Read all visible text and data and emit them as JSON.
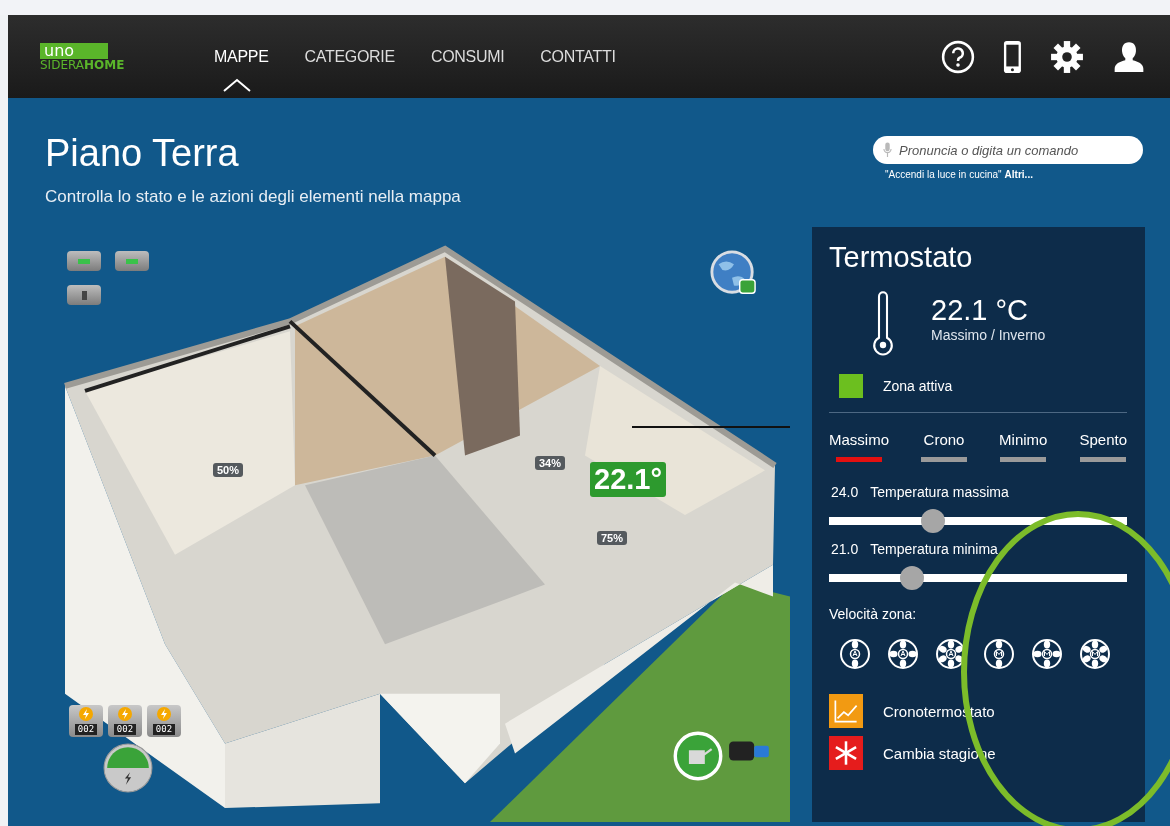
{
  "brand": {
    "top": "uno",
    "bottom_a": "SIDERA",
    "bottom_b": "HOME"
  },
  "nav": [
    {
      "label": "MAPPE",
      "selected": true
    },
    {
      "label": "CATEGORIE",
      "selected": false
    },
    {
      "label": "CONSUMI",
      "selected": false
    },
    {
      "label": "CONTATTI",
      "selected": false
    }
  ],
  "header_icons": [
    {
      "kind": "help"
    },
    {
      "kind": "phone"
    },
    {
      "kind": "settings"
    },
    {
      "kind": "user"
    }
  ],
  "page": {
    "title": "Piano Terra",
    "subtitle": "Controlla lo stato e le azioni degli elementi nella mappa"
  },
  "voice_search": {
    "placeholder": "Pronuncia o digita un comando",
    "hint": "\"Accendi la luce in cucina\"",
    "link": "Altri..."
  },
  "map": {
    "badges": [
      {
        "text": "50%",
        "kind": "humidity"
      },
      {
        "text": "34%",
        "kind": "humidity"
      },
      {
        "text": "22.1°",
        "kind": "temperature"
      },
      {
        "text": "75%",
        "kind": "humidity"
      }
    ],
    "meters": [
      {
        "reading": "002"
      },
      {
        "reading": "002"
      },
      {
        "reading": "002"
      }
    ]
  },
  "thermostat": {
    "title": "Termostato",
    "temperature": "22.1 °C",
    "mode_label": "Massimo / Inverno",
    "zone": {
      "label": "Zona attiva",
      "color": "#6cbf1f"
    },
    "modes": [
      {
        "label": "Massimo",
        "selected": true
      },
      {
        "label": "Crono",
        "selected": false
      },
      {
        "label": "Minimo",
        "selected": false
      },
      {
        "label": "Spento",
        "selected": false
      }
    ],
    "sliders": [
      {
        "value": "24.0",
        "label": "Temperatura massima",
        "level": 0.35
      },
      {
        "value": "21.0",
        "label": "Temperatura minima",
        "level": 0.28
      }
    ],
    "fan_label": "Velocità zona:",
    "fans": [
      {
        "kind": "auto"
      },
      {
        "kind": "auto"
      },
      {
        "kind": "auto"
      },
      {
        "kind": "manual"
      },
      {
        "kind": "manual"
      },
      {
        "kind": "manual"
      }
    ],
    "actions": [
      {
        "label": "Cronotermostato",
        "kind": "chart",
        "color": "#f29a12"
      },
      {
        "label": "Cambia stagione",
        "kind": "snow",
        "color": "#e51c1c"
      }
    ]
  }
}
